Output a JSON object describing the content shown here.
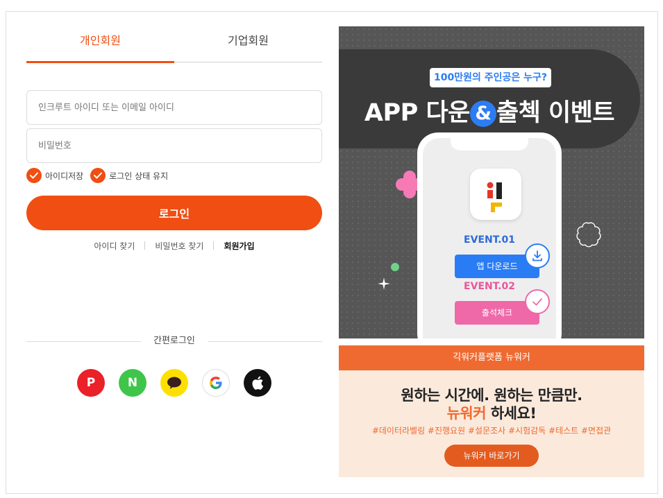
{
  "tabs": {
    "personal": "개인회원",
    "company": "기업회원"
  },
  "form": {
    "id_placeholder": "인크루트 아이디 또는 이메일 아이디",
    "pw_placeholder": "비밀번호",
    "save_id": "아이디저장",
    "keep_login": "로그인 상태 유지",
    "login_button": "로그인"
  },
  "links": {
    "find_id": "아이디 찾기",
    "find_pw": "비밀번호 찾기",
    "join": "회원가입"
  },
  "easy_login": {
    "label": "간편로그인",
    "providers": [
      {
        "name": "payco",
        "glyph": "P",
        "color": "#ea2128"
      },
      {
        "name": "naver",
        "glyph": "N",
        "color": "#3fc549"
      },
      {
        "name": "kakao",
        "glyph": "speech-bubble",
        "color": "#fde000"
      },
      {
        "name": "google",
        "glyph": "G",
        "color": "#ffffff"
      },
      {
        "name": "apple",
        "glyph": "apple",
        "color": "#111111"
      }
    ]
  },
  "banner": {
    "badge": "100만원의 주인공은 누구?",
    "title_before": "APP 다운",
    "title_amp": "&",
    "title_after": "출첵 이벤트",
    "event1_label": "EVENT.01",
    "event1_button": "앱 다운로드",
    "event2_label": "EVENT.02",
    "event2_button": "출석체크"
  },
  "newworker": {
    "header": "긱워커플랫폼 뉴워커",
    "line1": "원하는 시간에. 원하는 만큼만.",
    "line2_highlight": "뉴워커",
    "line2_rest": " 하세요!",
    "tags": "#데이터라벨링 #진행요원 #설문조사 #시험감독 #테스트 #면접관",
    "button": "뉴워커 바로가기"
  },
  "colors": {
    "accent": "#f04e12",
    "blue": "#2c7cf3",
    "pink": "#ef68a8",
    "newworker_orange": "#ef6a31"
  }
}
